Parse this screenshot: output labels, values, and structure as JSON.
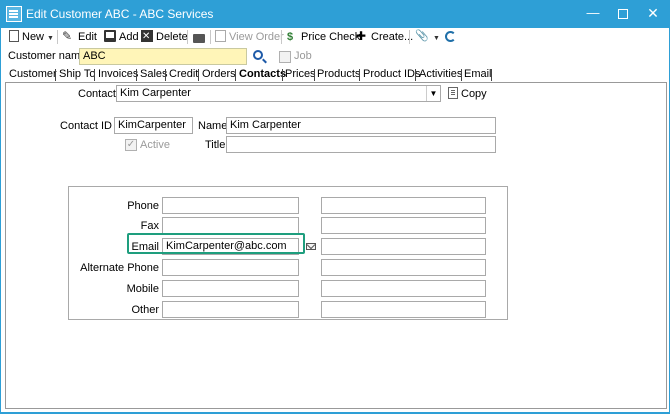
{
  "window": {
    "title": "Edit Customer ABC - ABC Services",
    "minimize": "—",
    "maximize": "",
    "close": "✕"
  },
  "toolbar": {
    "new_label": "New",
    "edit_label": "Edit",
    "add_label": "Add",
    "delete_label": "Delete",
    "view_order_label": "View Order",
    "price_check_label": "Price Check",
    "create_label": "Create...",
    "caret": "▼"
  },
  "customer": {
    "name_label": "Customer name",
    "name_value": "ABC",
    "job_label": "Job"
  },
  "tabs": [
    "Customer",
    "Ship To",
    "Invoices",
    "Sales",
    "Credit",
    "Orders",
    "Contacts",
    "Prices",
    "Products",
    "Product IDs",
    "Activities",
    "Email"
  ],
  "active_tab": "Contacts",
  "contact": {
    "selector_label": "Contact",
    "selected": "Kim Carpenter",
    "copy_label": "Copy",
    "id_label": "Contact ID",
    "id_value": "KimCarpenter",
    "name_label": "Name",
    "name_value": "Kim Carpenter",
    "active_label": "Active",
    "active_checked": true,
    "title_label": "Title",
    "title_value": ""
  },
  "details": {
    "phone_label": "Phone",
    "fax_label": "Fax",
    "email_label": "Email",
    "email_value": "KimCarpenter@abc.com",
    "alt_phone_label": "Alternate Phone",
    "mobile_label": "Mobile",
    "other_label": "Other"
  },
  "colors": {
    "titlebar": "#2e9fd6",
    "highlight": "#1e9e7e",
    "customer_name_bg": "#fff5b8"
  }
}
